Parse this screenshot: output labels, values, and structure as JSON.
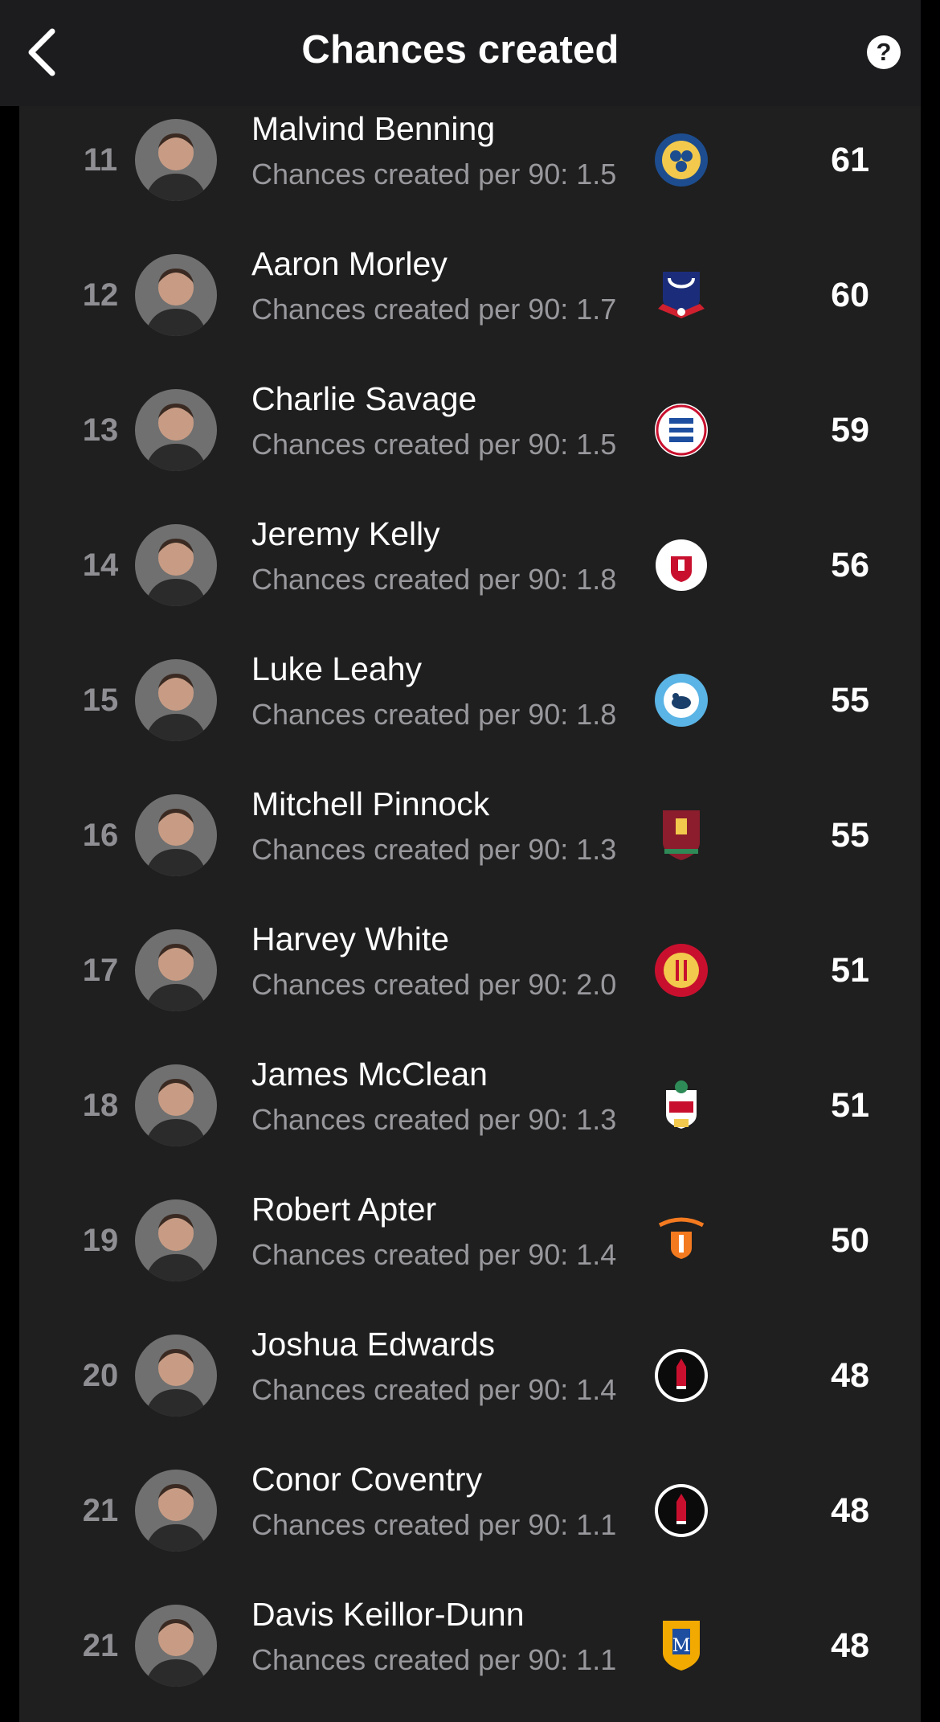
{
  "header": {
    "title": "Chances created",
    "back_label": "<",
    "help_label": "?"
  },
  "colors": {
    "background": "#1f1f1f",
    "header_bg": "#1c1c1e",
    "rank_color": "#8e8e93",
    "subtitle_color": "#98989d"
  },
  "players": [
    {
      "rank": "11",
      "name": "Malvind Benning",
      "subtitle": "Chances created per 90: 1.5",
      "value": "61",
      "team_icon": "shrewsbury-town-crest-icon"
    },
    {
      "rank": "12",
      "name": "Aaron Morley",
      "subtitle": "Chances created per 90: 1.7",
      "value": "60",
      "team_icon": "bolton-wanderers-crest-icon"
    },
    {
      "rank": "13",
      "name": "Charlie Savage",
      "subtitle": "Chances created per 90: 1.5",
      "value": "59",
      "team_icon": "reading-crest-icon"
    },
    {
      "rank": "14",
      "name": "Jeremy Kelly",
      "subtitle": "Chances created per 90: 1.8",
      "value": "56",
      "team_icon": "crawley-town-crest-icon"
    },
    {
      "rank": "15",
      "name": "Luke Leahy",
      "subtitle": "Chances created per 90: 1.8",
      "value": "55",
      "team_icon": "wycombe-wanderers-crest-icon"
    },
    {
      "rank": "16",
      "name": "Mitchell Pinnock",
      "subtitle": "Chances created per 90: 1.3",
      "value": "55",
      "team_icon": "northampton-town-crest-icon"
    },
    {
      "rank": "17",
      "name": "Harvey White",
      "subtitle": "Chances created per 90: 2.0",
      "value": "51",
      "team_icon": "stevenage-crest-icon"
    },
    {
      "rank": "18",
      "name": "James McClean",
      "subtitle": "Chances created per 90: 1.3",
      "value": "51",
      "team_icon": "wrexham-crest-icon"
    },
    {
      "rank": "19",
      "name": "Robert Apter",
      "subtitle": "Chances created per 90: 1.4",
      "value": "50",
      "team_icon": "blackpool-crest-icon"
    },
    {
      "rank": "20",
      "name": "Joshua Edwards",
      "subtitle": "Chances created per 90: 1.4",
      "value": "48",
      "team_icon": "charlton-athletic-crest-icon"
    },
    {
      "rank": "21",
      "name": "Conor Coventry",
      "subtitle": "Chances created per 90: 1.1",
      "value": "48",
      "team_icon": "charlton-athletic-crest-icon"
    },
    {
      "rank": "21",
      "name": "Davis Keillor-Dunn",
      "subtitle": "Chances created per 90: 1.1",
      "value": "48",
      "team_icon": "mansfield-town-crest-icon"
    }
  ]
}
